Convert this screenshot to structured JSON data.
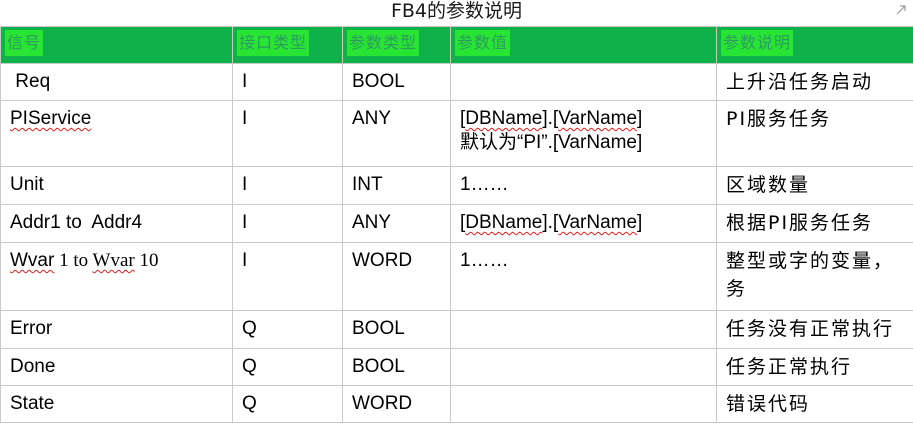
{
  "title": "FB4的参数说明",
  "headers": {
    "signal": "信号",
    "interface_type": "接口类型",
    "param_type": "参数类型",
    "param_value": "参数值",
    "param_desc": "参数说明"
  },
  "rows": [
    {
      "signal": " Req",
      "iface": "I",
      "ptype": "BOOL",
      "pvalue_1": "",
      "pvalue_2": "",
      "desc_1": "上升沿任务启动",
      "desc_2": ""
    },
    {
      "signal": "PIService",
      "iface": "I",
      "ptype": "ANY",
      "pvalue_1": "[DBName].[VarName]",
      "pvalue_2": "默认为“PI”.[VarName]",
      "desc_1": "PI服务任务",
      "desc_2": ""
    },
    {
      "signal": "Unit",
      "iface": "I",
      "ptype": "INT",
      "pvalue_1": "1……",
      "pvalue_2": "",
      "desc_1": "区域数量",
      "desc_2": ""
    },
    {
      "signal": "Addr1 to  Addr4",
      "iface": "I",
      "ptype": "ANY",
      "pvalue_1": "[DBName].[VarName]",
      "pvalue_2": "",
      "desc_1": "根据PI服务任务",
      "desc_2": ""
    },
    {
      "signal": "Wvar 1 to Wvar 10",
      "iface": "I",
      "ptype": "WORD",
      "pvalue_1": "1……",
      "pvalue_2": "",
      "desc_1": "整型或字的变量，",
      "desc_2": "务"
    },
    {
      "signal": "Error",
      "iface": "Q",
      "ptype": "BOOL",
      "pvalue_1": "",
      "pvalue_2": "",
      "desc_1": "任务没有正常执行",
      "desc_2": ""
    },
    {
      "signal": "Done",
      "iface": "Q",
      "ptype": "BOOL",
      "pvalue_1": "",
      "pvalue_2": "",
      "desc_1": "任务正常执行",
      "desc_2": ""
    },
    {
      "signal": "State",
      "iface": "Q",
      "ptype": "WORD",
      "pvalue_1": "",
      "pvalue_2": "",
      "desc_1": "错误代码",
      "desc_2": ""
    }
  ],
  "wvar_parts": {
    "a": "Wvar",
    "b": " 1 to ",
    "c": "Wvar",
    "d": " 10"
  },
  "pis_parts": {
    "dbname": "DBName",
    "varname": "VarName",
    "varname2": "VarName"
  },
  "addr_parts": {
    "dbname": "DBName",
    "varname": "VarName"
  },
  "colors": {
    "header_bg": "#0fb24a",
    "header_text_bg": "#27e532",
    "header_text": "#2e9a62",
    "border": "#c9c9c9",
    "spellcheck": "#d92020"
  },
  "icons": {
    "corner": "resize-arrow-icon"
  }
}
